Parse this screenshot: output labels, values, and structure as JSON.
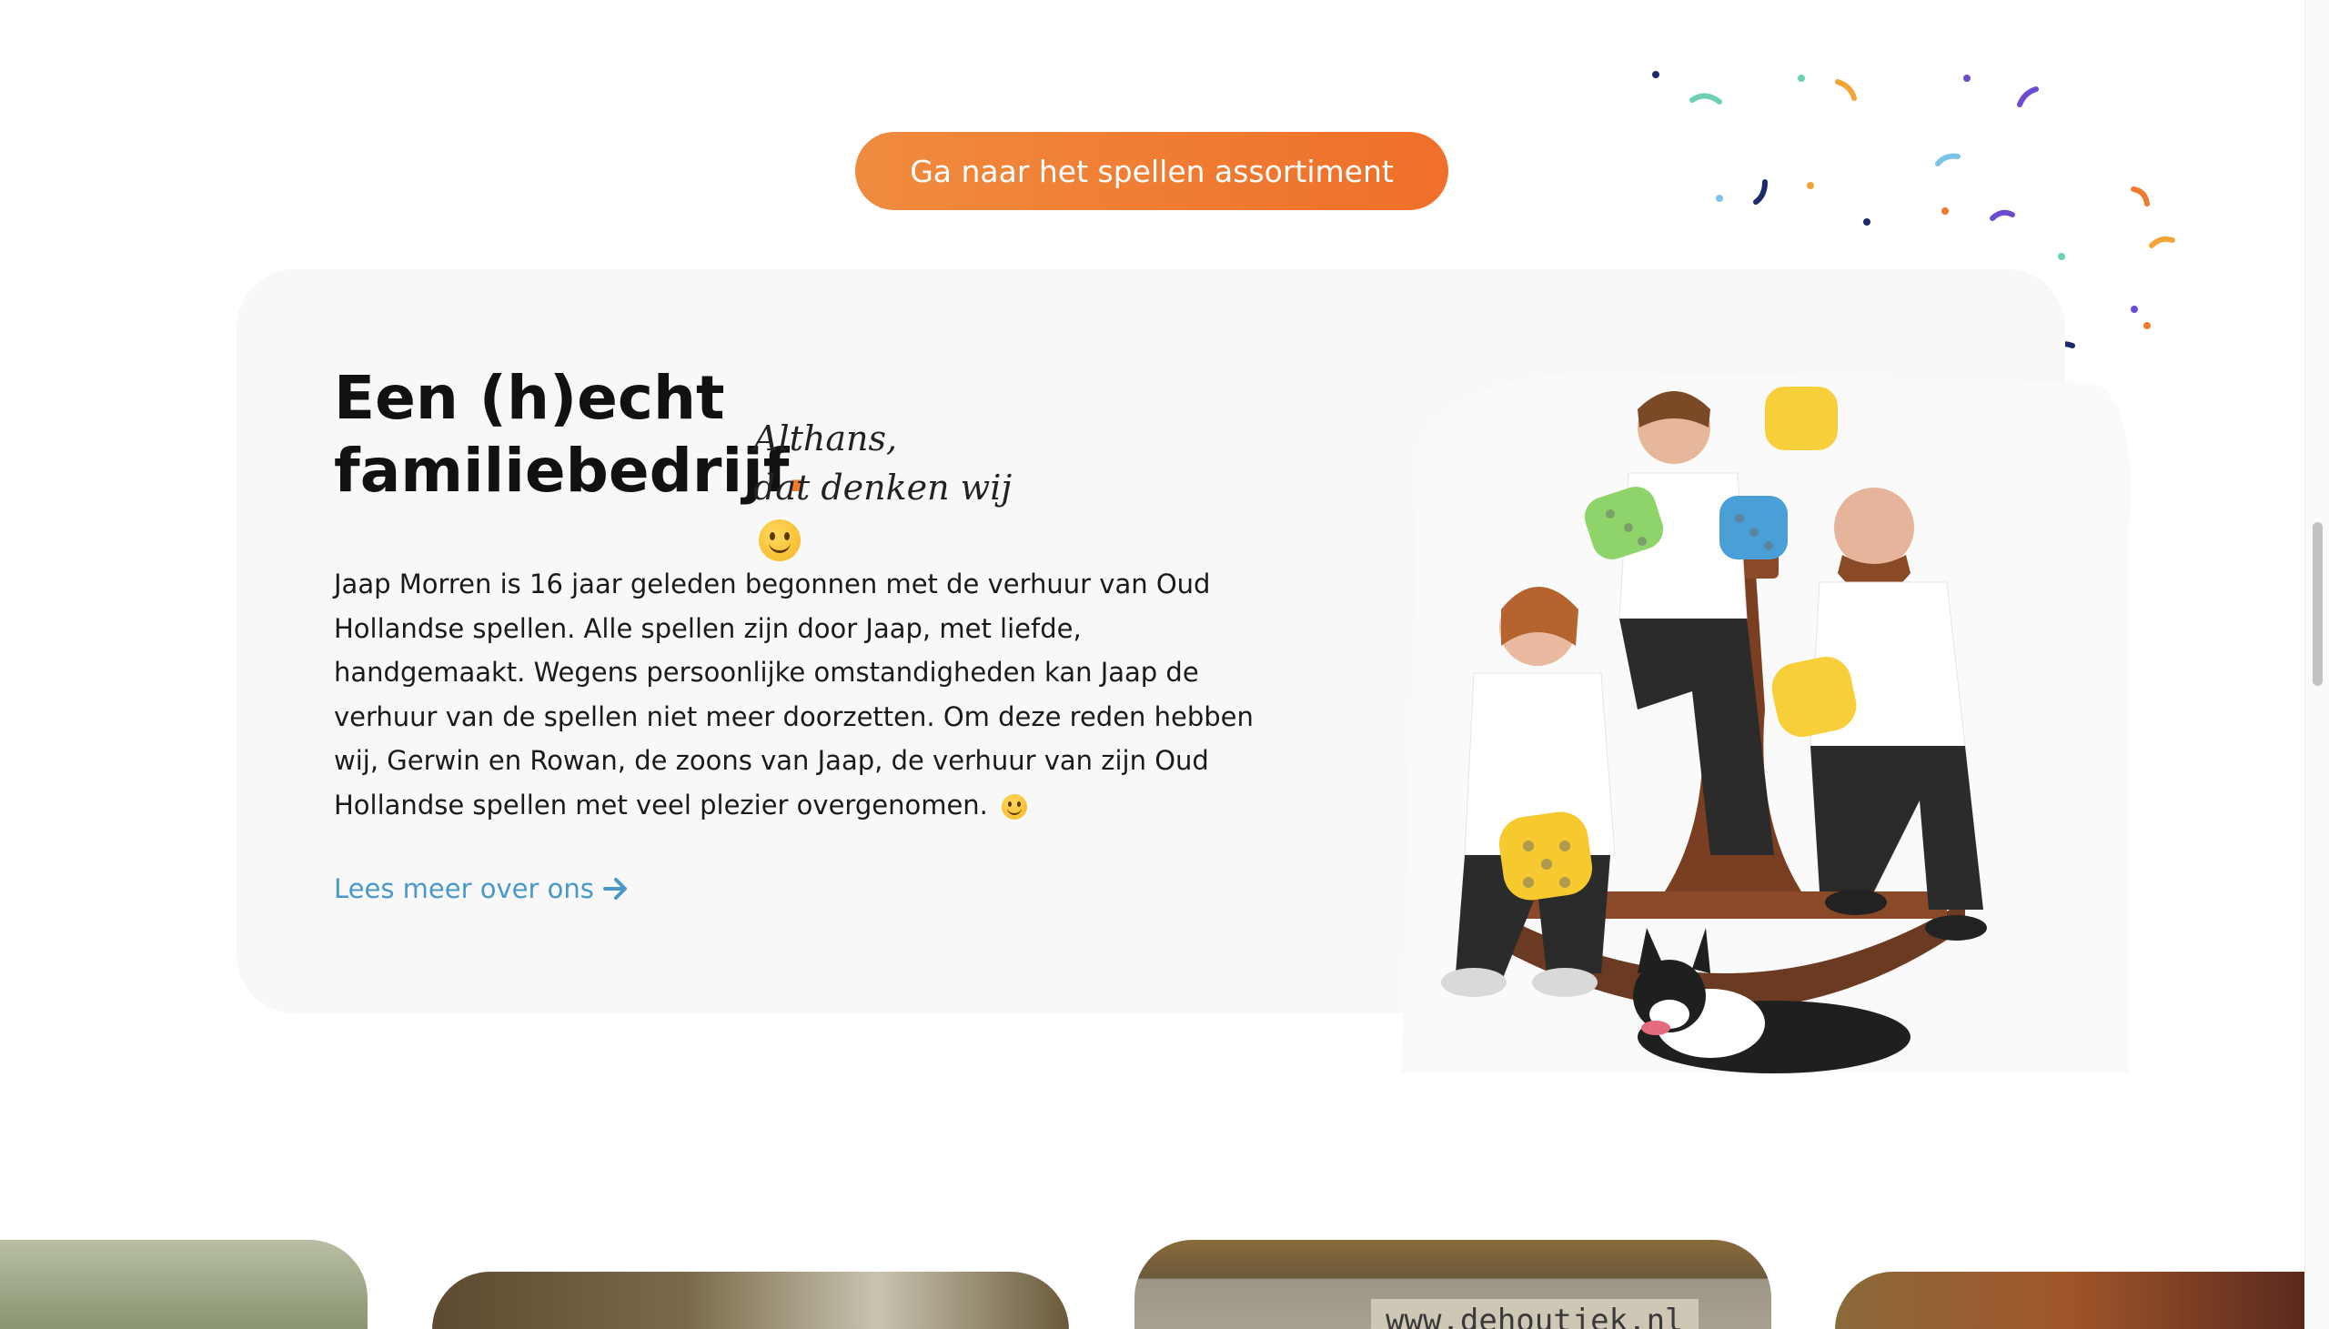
{
  "cta": {
    "label": "Ga naar het spellen assortiment"
  },
  "about": {
    "heading_line1": "Een (h)echt",
    "heading_line2": "familiebedrijf",
    "heading_dot": ".",
    "script_line1": "Althans,",
    "script_line2": "dat denken wij",
    "body": "Jaap Morren is 16 jaar geleden begonnen met de verhuur van Oud Hollandse spellen. Alle spellen zijn door Jaap, met liefde, handgemaakt. Wegens persoonlijke omstandigheden kan Jaap de verhuur van de spellen niet meer doorzetten. Om deze reden hebben wij, Gerwin en Rowan, de zoons van Jaap, de verhuur van zijn Oud Hollandse spellen met veel plezier overgenomen.",
    "link_label": "Lees meer over ons",
    "link_icon": "arrow-right-icon"
  },
  "gallery": {
    "sign_text": "www.dehoutjek.nl"
  },
  "colors": {
    "accent_orange": "#ef7a32",
    "link_blue": "#4a97c9",
    "card_bg": "#f8f8f8"
  }
}
